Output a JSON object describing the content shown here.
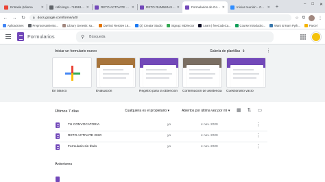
{
  "browser": {
    "tabs": [
      {
        "title": "Entrada (Idioma",
        "color": "#ea4335",
        "active": false
      },
      {
        "title": "rafic/argo - *185918?",
        "color": "#5f6368",
        "active": false
      },
      {
        "title": "RETO ACTIVATE 2020",
        "color": "#7248b9",
        "active": false
      },
      {
        "title": "RETO RUMMMAS - TCO",
        "color": "#7248b9",
        "active": false
      },
      {
        "title": "Formularios de Google",
        "color": "#7248b9",
        "active": true
      },
      {
        "title": "Iniciar reunión - Zoom",
        "color": "#2d8cff",
        "active": false
      }
    ],
    "newtab_symbol": "+",
    "window_controls": [
      "–",
      "□",
      "✕"
    ],
    "url": "docs.google.com/forms/u/0/",
    "bookmarks": [
      {
        "label": "Aplicaciones",
        "color": "#4285f4"
      },
      {
        "label": "Preprocesamiento...",
        "color": "#5f6368"
      },
      {
        "label": "Library Genesis: sa...",
        "color": "#a1887f"
      },
      {
        "label": "DaVinci Resolve 16...",
        "color": "#e37400"
      },
      {
        "label": "(2) Creator Studio",
        "color": "#1877f2"
      },
      {
        "label": "Signup: MDirector",
        "color": "#34a853"
      },
      {
        "label": "Learn | freeCodeCa...",
        "color": "#0a0a23"
      },
      {
        "label": "Course introductio...",
        "color": "#0f9d58"
      },
      {
        "label": "Want to learn Pyth...",
        "color": "#3776ab"
      },
      {
        "label": "Parcel",
        "color": "#f4b400"
      }
    ]
  },
  "app": {
    "title": "Formularios",
    "search_placeholder": "Búsqueda"
  },
  "gallery": {
    "start_label": "Iniciar un formulario nuevo",
    "gallery_link": "Galería de plantillas",
    "templates": [
      {
        "label": "En blanco",
        "kind": "blank",
        "accent": "#ffffff"
      },
      {
        "label": "Evaluación",
        "kind": "photo",
        "accent": "#a8753c"
      },
      {
        "label": "Registro para la obtención",
        "kind": "band",
        "accent": "#7248b9"
      },
      {
        "label": "Confirmación de asistencia",
        "kind": "photo",
        "accent": "#7a6e62"
      },
      {
        "label": "Cuestionario vacío",
        "kind": "band",
        "accent": "#7248b9"
      }
    ]
  },
  "recent": {
    "title": "Últimos 7 días",
    "owner_filter": "Cualquiera es el propietario",
    "sort_filter": "Abiertos por última vez por mí",
    "forms": [
      {
        "name": "TU CONVOCATORIA",
        "owner": "yo",
        "date": "4 nov. 2020"
      },
      {
        "name": "RETO ACTIVATE 2020",
        "owner": "yo",
        "date": "4 nov. 2020"
      },
      {
        "name": "Formulario sin título",
        "owner": "yo",
        "date": "4 nov. 2020"
      }
    ],
    "older_title": "Anteriores"
  }
}
